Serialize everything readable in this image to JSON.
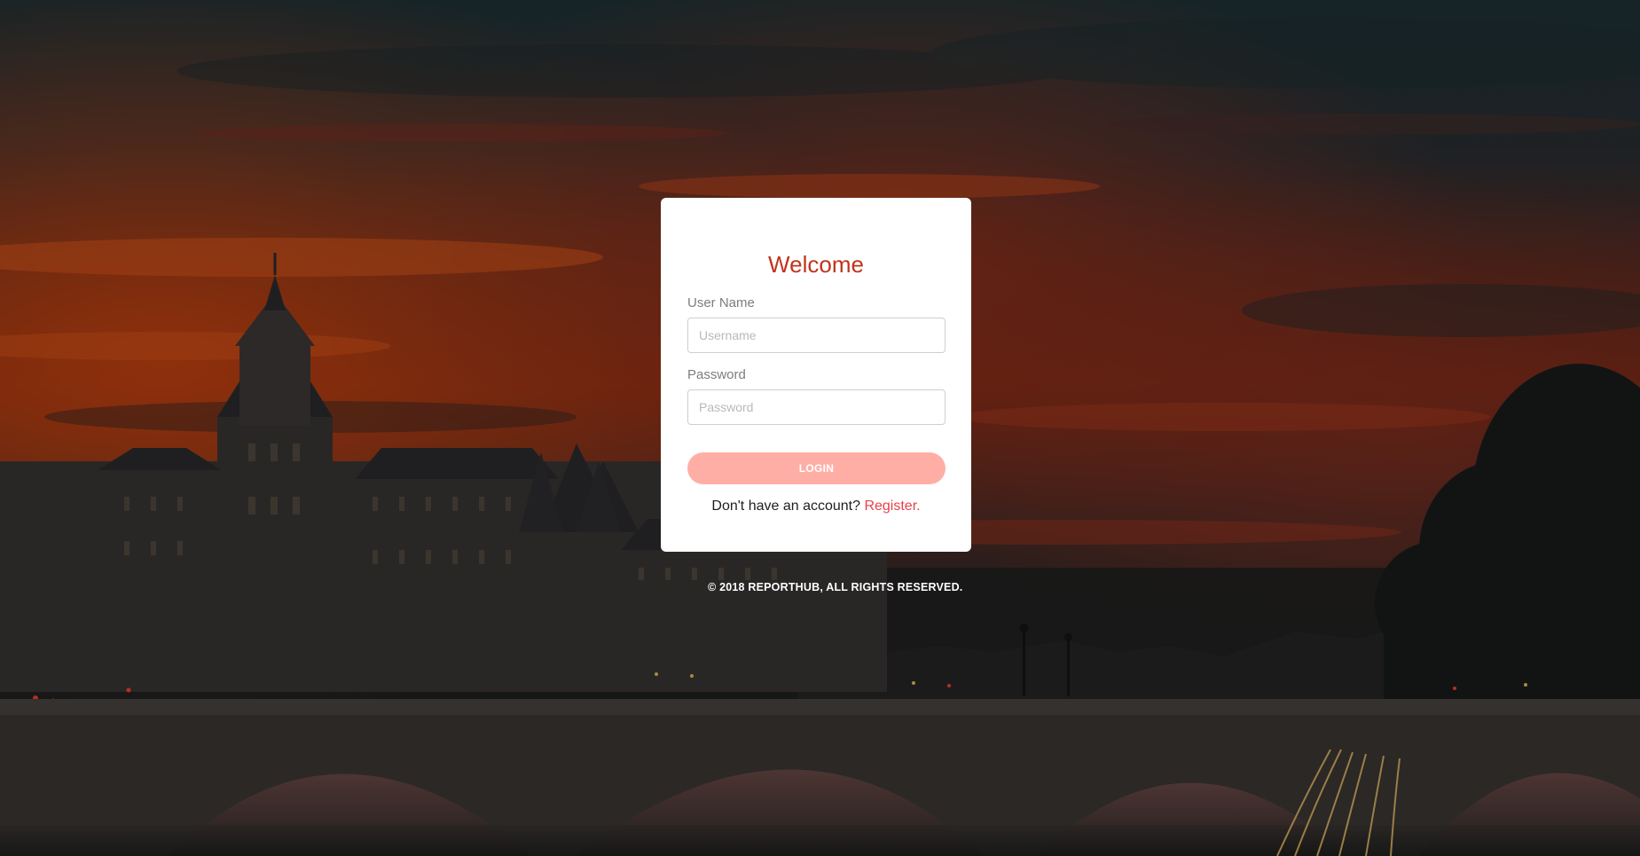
{
  "login": {
    "title": "Welcome",
    "username_label": "User Name",
    "username_placeholder": "Username",
    "username_value": "",
    "password_label": "Password",
    "password_placeholder": "Password",
    "password_value": "",
    "login_button": "LOGIN",
    "register_prompt": "Don't have an account?",
    "register_link": "Register."
  },
  "footer": {
    "copyright": "© 2018 REPORTHUB, ALL RIGHTS RESERVED."
  },
  "colors": {
    "title": "#c0341d",
    "button": "#ffaea6",
    "link": "#e8414a"
  }
}
